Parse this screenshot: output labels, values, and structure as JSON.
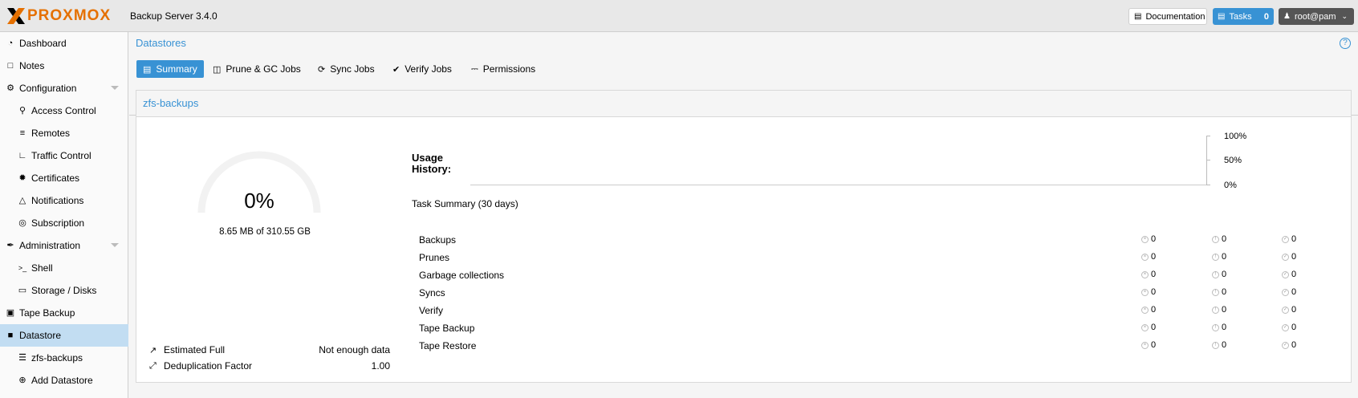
{
  "header": {
    "logo_text": "PROXMOX",
    "product": "Backup Server 3.4.0",
    "documentation_label": "Documentation",
    "tasks_label": "Tasks",
    "tasks_count": "0",
    "user_label": "root@pam"
  },
  "sidebar": {
    "items": [
      {
        "label": "Dashboard",
        "icon": "dashboard-icon"
      },
      {
        "label": "Notes",
        "icon": "note-icon"
      },
      {
        "label": "Configuration",
        "icon": "cogs-icon"
      },
      {
        "label": "Access Control",
        "icon": "key-icon"
      },
      {
        "label": "Remotes",
        "icon": "server-icon"
      },
      {
        "label": "Traffic Control",
        "icon": "traffic-icon"
      },
      {
        "label": "Certificates",
        "icon": "certificate-icon"
      },
      {
        "label": "Notifications",
        "icon": "bell-icon"
      },
      {
        "label": "Subscription",
        "icon": "support-icon"
      },
      {
        "label": "Administration",
        "icon": "wrench-icon"
      },
      {
        "label": "Shell",
        "icon": "terminal-icon"
      },
      {
        "label": "Storage / Disks",
        "icon": "hdd-icon"
      },
      {
        "label": "Tape Backup",
        "icon": "tape-icon"
      },
      {
        "label": "Datastore",
        "icon": "archive-icon"
      },
      {
        "label": "zfs-backups",
        "icon": "database-icon"
      },
      {
        "label": "Add Datastore",
        "icon": "plus-circle-icon"
      }
    ]
  },
  "main": {
    "title": "Datastores",
    "tabs": [
      {
        "label": "Summary",
        "icon": "book-icon"
      },
      {
        "label": "Prune & GC Jobs",
        "icon": "trash-icon"
      },
      {
        "label": "Sync Jobs",
        "icon": "refresh-icon"
      },
      {
        "label": "Verify Jobs",
        "icon": "check-circle-icon"
      },
      {
        "label": "Permissions",
        "icon": "unlock-icon"
      }
    ]
  },
  "panel": {
    "title": "zfs-backups",
    "usage_percent_text": "0%",
    "usage_percent": 0,
    "usage_text": "8.65 MB of 310.55 GB",
    "estimated_full_label": "Estimated Full",
    "estimated_full_value": "Not enough data",
    "dedup_label": "Deduplication Factor",
    "dedup_value": "1.00",
    "usage_history_label": "Usage History:",
    "axis_100": "100%",
    "axis_50": "50%",
    "axis_0": "0%",
    "task_summary_label": "Task Summary (30 days)",
    "task_rows": [
      {
        "label": "Backups",
        "errors": "0",
        "warnings": "0",
        "ok": "0"
      },
      {
        "label": "Prunes",
        "errors": "0",
        "warnings": "0",
        "ok": "0"
      },
      {
        "label": "Garbage collections",
        "errors": "0",
        "warnings": "0",
        "ok": "0"
      },
      {
        "label": "Syncs",
        "errors": "0",
        "warnings": "0",
        "ok": "0"
      },
      {
        "label": "Verify",
        "errors": "0",
        "warnings": "0",
        "ok": "0"
      },
      {
        "label": "Tape Backup",
        "errors": "0",
        "warnings": "0",
        "ok": "0"
      },
      {
        "label": "Tape Restore",
        "errors": "0",
        "warnings": "0",
        "ok": "0"
      }
    ]
  },
  "colors": {
    "accent": "#3892d4",
    "logo_orange": "#e57000",
    "selected_bg": "#c2ddf2"
  }
}
